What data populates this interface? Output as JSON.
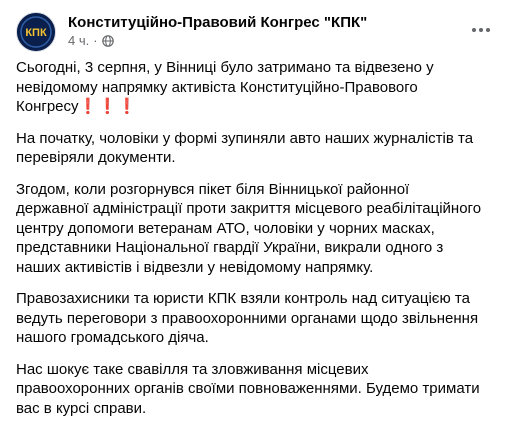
{
  "post": {
    "page_name": "Конституційно-Правовий Конгрес \"КПК\"",
    "time": "4 ч.",
    "separator": "·",
    "avatar_text": "КПК",
    "paragraphs": [
      "Сьогодні, 3 серпня, у Вінниці  було затримано та відвезено у\nневідомому напрямку активіста Конституційно-Правового\nКонгресу",
      "На початку, чоловіки у формі зупиняли авто наших журналістів та\nперевіряли документи.",
      "Згодом, коли розгорнувся пікет біля Вінницької районної\nдержавної адміністрації проти закриття місцевого реабілітаційного\nцентру допомоги ветеранам АТО, чоловіки у чорних масках,\nпредставники Національної гвардії України, викрали одного з\nнаших активістів і відвезли у невідомому напрямку.",
      "Правозахисники та юристи КПК взяли контроль над ситуацією та\nведуть переговори з правоохоронними органами щодо звільнення\nнашого громадського діяча.",
      "Нас шокує таке свавілля та зловживання місцевих\nправоохоронних органів своїми повноваженнями. Будемо тримати\nвас в курсі справи."
    ],
    "emphasis": "❗❗❗",
    "icons": {
      "privacy": "globe-icon",
      "more": "more-options-icon"
    },
    "colors": {
      "text": "#050505",
      "secondary": "#65676b",
      "avatar_bg": "#0b1f4d",
      "avatar_accent": "#f2c230",
      "emphasis": "#e02525"
    }
  }
}
